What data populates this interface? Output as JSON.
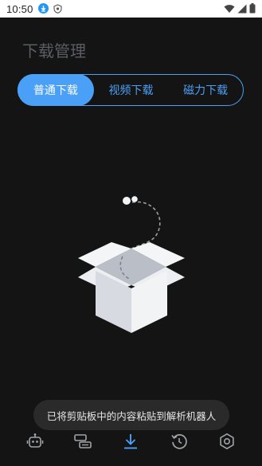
{
  "status_bar": {
    "time": "10:50",
    "icons": [
      "download-notification-icon",
      "shield-notification-icon",
      "wifi-icon",
      "signal-icon",
      "battery-icon"
    ]
  },
  "page": {
    "title": "下载管理"
  },
  "tabs": [
    {
      "label": "普通下载",
      "active": true
    },
    {
      "label": "视频下载",
      "active": false
    },
    {
      "label": "磁力下载",
      "active": false
    }
  ],
  "empty_state": {
    "illustration": "open-box-icon"
  },
  "toast": {
    "message": "已将剪贴板中的内容粘贴到解析机器人"
  },
  "bottom_nav": [
    {
      "icon": "robot-icon",
      "active": false
    },
    {
      "icon": "transfer-icon",
      "active": false
    },
    {
      "icon": "download-icon",
      "active": true
    },
    {
      "icon": "history-icon",
      "active": false
    },
    {
      "icon": "settings-icon",
      "active": false
    }
  ],
  "colors": {
    "accent": "#4aa0f6",
    "background": "#141414",
    "title_gray": "#5a5d63",
    "nav_icon_gray": "#a0a3a8",
    "toast_bg": "#2a2a2a"
  }
}
